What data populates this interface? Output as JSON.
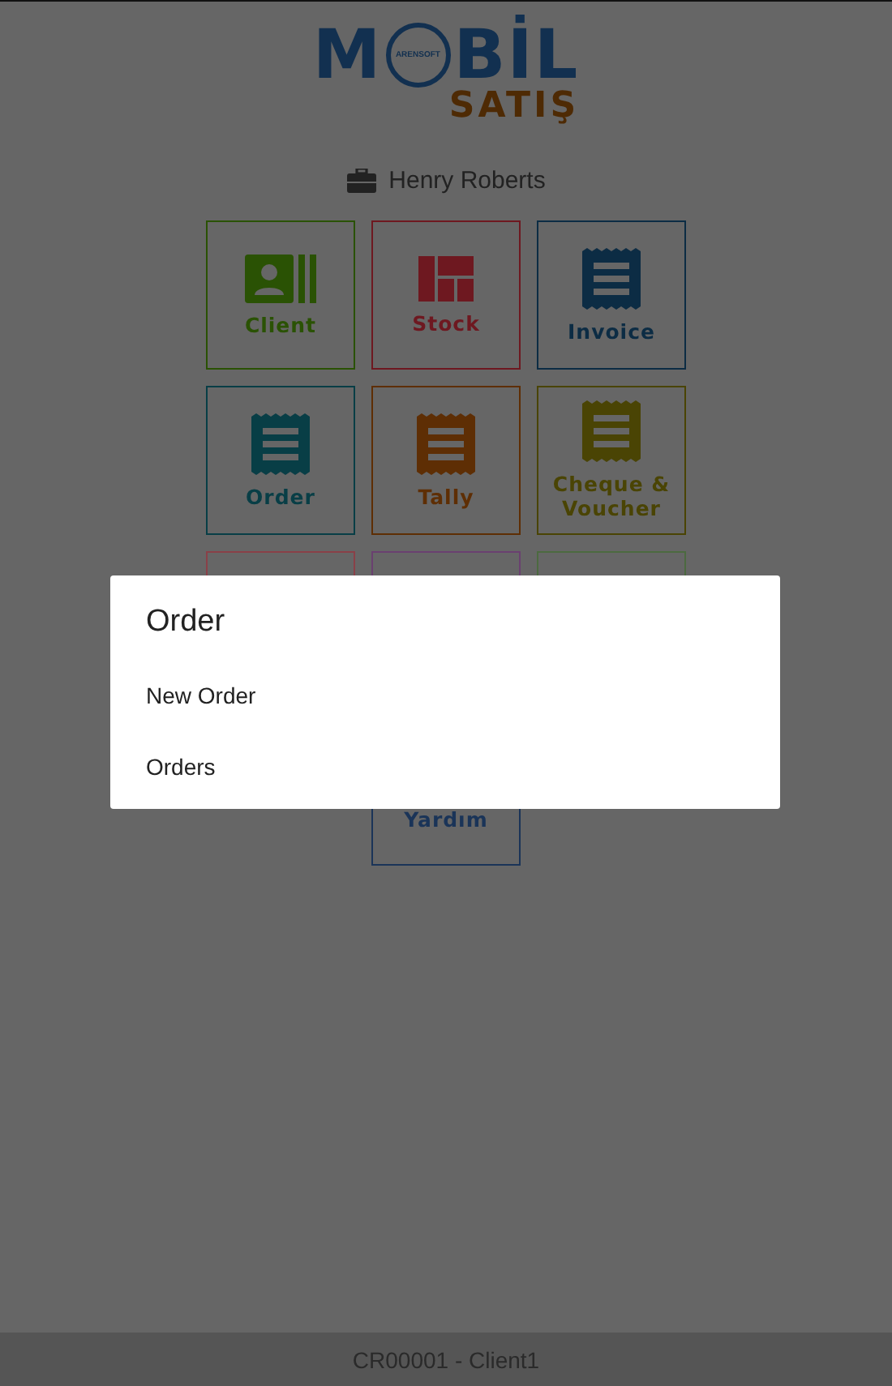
{
  "logo": {
    "left": "M",
    "emblem_text": "ARENSOFT",
    "right": "BİL",
    "tagline": "SATIŞ"
  },
  "user": {
    "name": "Henry Roberts"
  },
  "tiles": [
    {
      "label": "Client",
      "kind": "contact",
      "color": "#2a5204"
    },
    {
      "label": "Stock",
      "kind": "grid",
      "color": "#6e1820"
    },
    {
      "label": "Invoice",
      "kind": "receipt",
      "color": "#0c2c44"
    },
    {
      "label": "Order",
      "kind": "receipt",
      "color": "#083e46"
    },
    {
      "label": "Tally",
      "kind": "receipt",
      "color": "#5e2e04"
    },
    {
      "label": "Cheque & Voucher",
      "kind": "receipt",
      "color": "#4a4404"
    },
    {
      "kind": "empty",
      "color": "#8a4048"
    },
    {
      "kind": "empty",
      "color": "#6a4070"
    },
    {
      "kind": "empty",
      "color": "#4c6a40"
    }
  ],
  "help_tile": {
    "label": "Yardım",
    "color": "#1a3458"
  },
  "dialog": {
    "title": "Order",
    "items": [
      "New Order",
      "Orders"
    ]
  },
  "status_bar": {
    "text": "CR00001 - Client1"
  }
}
